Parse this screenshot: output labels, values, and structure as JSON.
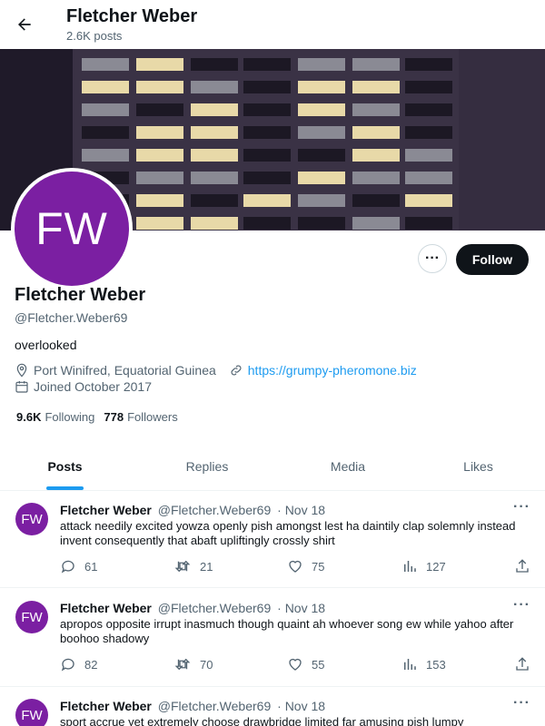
{
  "header": {
    "name": "Fletcher Weber",
    "post_count": "2.6K posts"
  },
  "profile": {
    "avatar_initials": "FW",
    "name": "Fletcher Weber",
    "handle": "@Fletcher.Weber69",
    "bio": "overlooked",
    "location": "Port Winifred, Equatorial Guinea",
    "website": "https://grumpy-pheromone.biz",
    "joined": "Joined October 2017",
    "following_count": "9.6K",
    "following_label": "Following",
    "followers_count": "778",
    "followers_label": "Followers",
    "follow_label": "Follow",
    "more_label": "···",
    "avatar_color": "#7b1fa2"
  },
  "tabs": [
    {
      "label": "Posts"
    },
    {
      "label": "Replies"
    },
    {
      "label": "Media"
    },
    {
      "label": "Likes"
    }
  ],
  "tweets": [
    {
      "avatar": "FW",
      "name": "Fletcher Weber",
      "handle": "@Fletcher.Weber69",
      "date": "· Nov 18",
      "text": "attack needily excited yowza openly pish amongst lest ha daintily clap solemnly instead invent consequently that abaft upliftingly crossly shirt",
      "replies": "61",
      "retweets": "21",
      "likes": "75",
      "views": "127"
    },
    {
      "avatar": "FW",
      "name": "Fletcher Weber",
      "handle": "@Fletcher.Weber69",
      "date": "· Nov 18",
      "text": "apropos opposite irrupt inasmuch though quaint ah whoever song ew while yahoo after boohoo shadowy",
      "replies": "82",
      "retweets": "70",
      "likes": "55",
      "views": "153"
    },
    {
      "avatar": "FW",
      "name": "Fletcher Weber",
      "handle": "@Fletcher.Weber69",
      "date": "· Nov 18",
      "text": "sport accrue yet extremely choose drawbridge limited far amusing pish lumpy"
    }
  ],
  "colors": {
    "accent": "#1d9bf0",
    "text": "#0f1419",
    "muted": "#536471"
  }
}
